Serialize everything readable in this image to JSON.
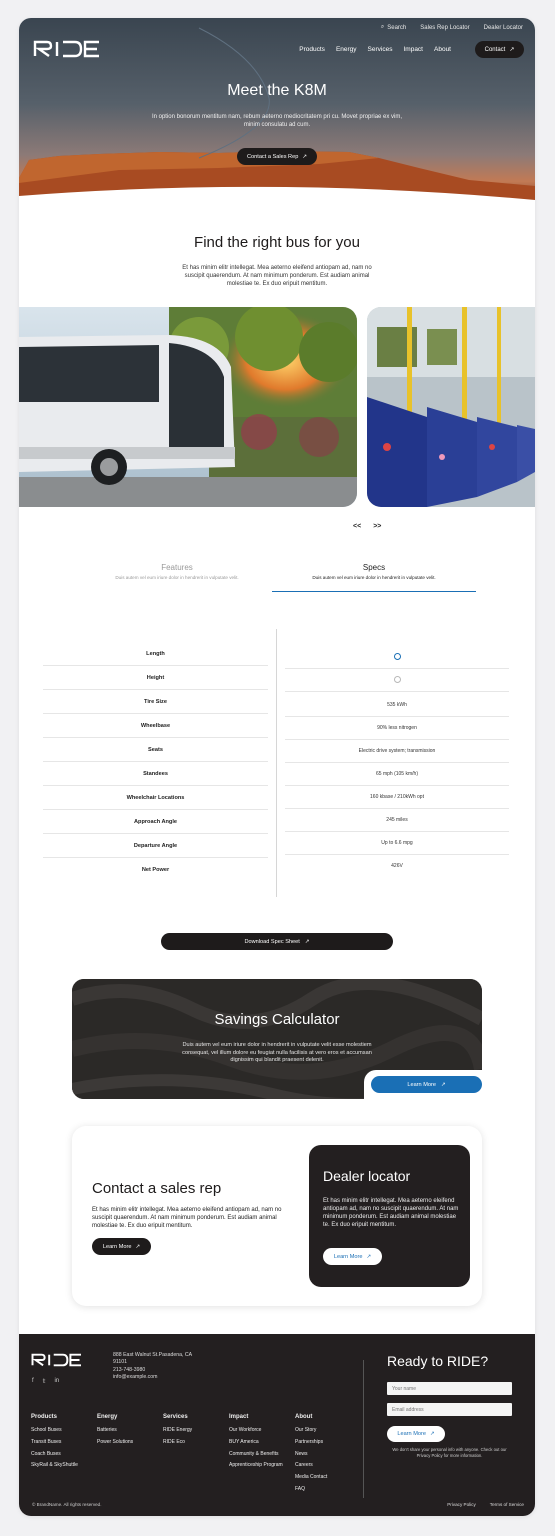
{
  "brand": "RIDE",
  "topbar": {
    "search": "Search",
    "sales_rep": "Sales Rep Locator",
    "dealer": "Dealer Locator"
  },
  "nav": {
    "items": [
      "Products",
      "Energy",
      "Services",
      "Impact",
      "About"
    ],
    "contact": "Contact"
  },
  "hero": {
    "title": "Meet the K8M",
    "body": "In option bonorum mentitum nam, rebum aeterno mediocritatem pri cu. Movet propriae ex vim, minim consulatu ad cum.",
    "cta": "Contact a Sales Rep"
  },
  "find": {
    "title": "Find the right bus for you",
    "body": "Et has minim elitr intellegat. Mea aeterno eleifend antiopam ad, nam no suscipit quaerendum. At nam minimum ponderum. Est audiam animal molestiae te. Ex duo eripuit mentitum.",
    "prev": "<<",
    "next": ">>"
  },
  "tabs": [
    {
      "title": "Features",
      "sub": "Duis autem vel eum iriure dolor in hendrerit in vulputate velit."
    },
    {
      "title": "Specs",
      "sub": "Duis autem vel eum iriure dolor in hendrerit in vulputate velit."
    }
  ],
  "specs": {
    "labels": [
      "Length",
      "Height",
      "Tire Size",
      "Wheelbase",
      "Seats",
      "Standees",
      "Wheelchair Locations",
      "Approach Angle",
      "Departure Angle",
      "Net Power"
    ],
    "values": [
      "",
      "",
      "535 kWh",
      "90% less nitrogen",
      "Electric drive system; transmission",
      "65 mph (105 km/h)",
      "160 kbase / 210kWh opt",
      "245 miles",
      "Up to 6.6 mpg",
      "426V"
    ],
    "download": "Download Spec Sheet"
  },
  "savings": {
    "title": "Savings Calculator",
    "body": "Duis autem vel eum iriure dolor in hendrerit in vulputate velit esse molestiem consequat, vel illum dolore eu feugiat nulla facilisis at vero eros et accumsan dignissim qui blandit praesent delenit.",
    "cta": "Learn More"
  },
  "contact": {
    "title": "Contact a sales rep",
    "body": "Et has minim elitr intellegat. Mea aeterno eleifend antiopam ad, nam no suscipit quaerendum. At nam minimum ponderum. Est audiam animal molestiae te. Ex duo eripuit mentitum.",
    "cta": "Learn More"
  },
  "dealer": {
    "title": "Dealer locator",
    "body": "Et has minim elitr intellegat. Mea aeterno eleifend antiopam ad, nam no suscipit quaerendum. At nam minimum ponderum. Est audiam animal molestiae te. Ex duo eripuit mentitum.",
    "cta": "Learn More"
  },
  "footer": {
    "addr1": "888 East Walnut St.Pasadena, CA",
    "addr2": "91101",
    "phone": "213-748-3980",
    "email": "info@example.com",
    "cols": [
      {
        "title": "Products",
        "links": [
          "School Buses",
          "Transit Buses",
          "Coach Buses",
          "SkyRail & SkyShuttle"
        ]
      },
      {
        "title": "Energy",
        "links": [
          "Batteries",
          "Power Solutions"
        ]
      },
      {
        "title": "Services",
        "links": [
          "RIDE Energy",
          "RIDE Eco"
        ]
      },
      {
        "title": "Impact",
        "links": [
          "Our Workforce",
          "BUY America",
          "Community & Benefits",
          "Apprenticeship Program"
        ]
      },
      {
        "title": "About",
        "links": [
          "Our Story",
          "Partnerships",
          "News",
          "Careers",
          "Media Contact",
          "FAQ"
        ]
      }
    ],
    "ready": "Ready to RIDE?",
    "name_ph": "Your name",
    "email_ph": "Email address",
    "subscribe": "Learn More",
    "privacy": "We don't share your personal info with anyone. Check out our Privacy Policy for more information.",
    "copyright": "© BrandName. All rights reserved.",
    "privacy_link": "Privacy Policy",
    "terms": "Terms of Service"
  },
  "colors": {
    "accent": "#1a6fb5",
    "dark": "#231f20"
  }
}
